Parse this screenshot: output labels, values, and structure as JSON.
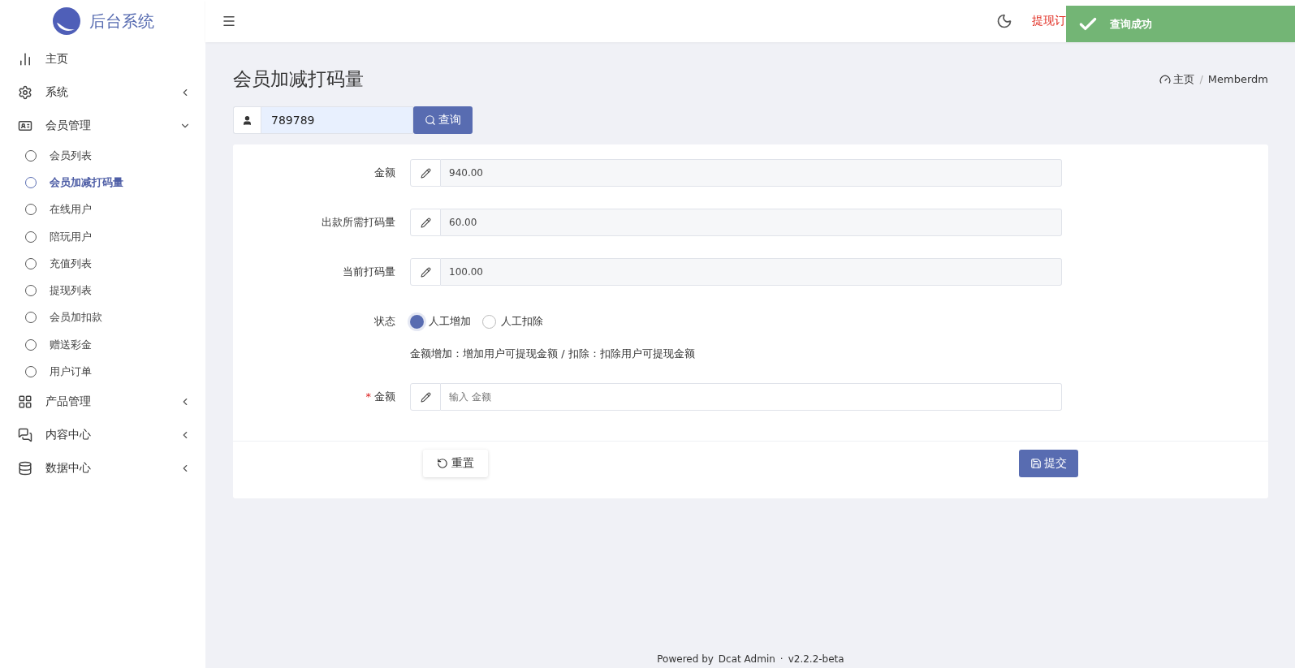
{
  "brand": {
    "title": "后台系统"
  },
  "sidebar": {
    "items": [
      {
        "label": "主页",
        "selected": false
      },
      {
        "label": "系统",
        "expanded": false,
        "selected": false
      },
      {
        "label": "会员管理",
        "expanded": true,
        "selected": false,
        "children": [
          {
            "label": "会员列表",
            "selected": false
          },
          {
            "label": "会员加减打码量",
            "selected": true
          },
          {
            "label": "在线用户",
            "selected": false
          },
          {
            "label": "陪玩用户",
            "selected": false
          },
          {
            "label": "充值列表",
            "selected": false
          },
          {
            "label": "提现列表",
            "selected": false
          },
          {
            "label": "会员加扣款",
            "selected": false
          },
          {
            "label": "赠送彩金",
            "selected": false
          },
          {
            "label": "用户订单",
            "selected": false
          }
        ]
      },
      {
        "label": "产品管理",
        "expanded": false,
        "selected": false
      },
      {
        "label": "内容中心",
        "expanded": false,
        "selected": false
      },
      {
        "label": "数据中心",
        "expanded": false,
        "selected": false
      }
    ]
  },
  "header": {
    "notice": "提现订"
  },
  "toast": {
    "message": "查询成功"
  },
  "page": {
    "title": "会员加减打码量",
    "breadcrumb": [
      "主页",
      "Memberdm"
    ],
    "breadcrumb_separator": "/"
  },
  "search": {
    "value": "789789",
    "button": "查询"
  },
  "form": {
    "fields": [
      {
        "kind": "readonly",
        "label": "金额",
        "value": "940.00"
      },
      {
        "kind": "readonly",
        "label": "出款所需打码量",
        "value": "60.00"
      },
      {
        "kind": "readonly",
        "label": "当前打码量",
        "value": "100.00"
      },
      {
        "kind": "radio",
        "label": "状态",
        "options": [
          {
            "label": "人工增加",
            "selected": true
          },
          {
            "label": "人工扣除",
            "selected": false
          }
        ],
        "help": "金额增加：增加用户可提现金额 / 扣除：扣除用户可提现金额"
      },
      {
        "kind": "input",
        "label": "金额",
        "placeholder": "输入 金额",
        "required": true,
        "required_mark": "*"
      }
    ],
    "reset": "重置",
    "submit": "提交"
  },
  "footer": {
    "powered": "Powered by",
    "product": "Dcat Admin",
    "separator": "·",
    "version": "v2.2.2-beta"
  }
}
